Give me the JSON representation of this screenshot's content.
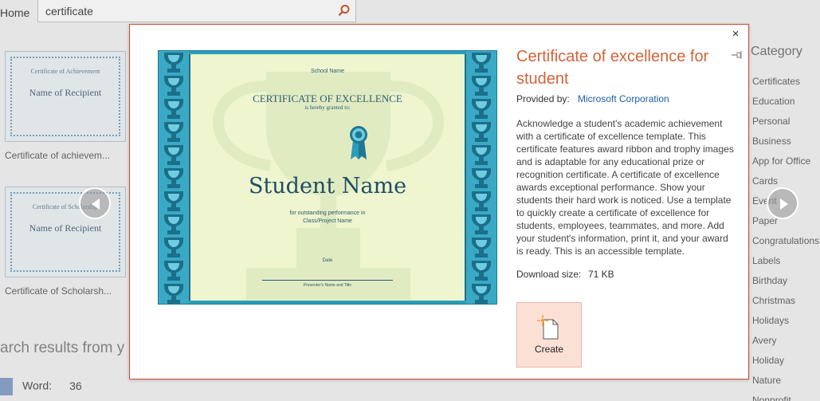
{
  "app": {
    "home_label": "Home",
    "search_value": "certificate"
  },
  "templates": [
    {
      "heading": "Certificate of Achievement",
      "recipient": "Name of Recipient",
      "label": "Certificate of achievem..."
    },
    {
      "heading": "Certificate of Scholarship",
      "recipient": "Name of Recipient",
      "label": "Certificate of Scholarsh..."
    }
  ],
  "search_results_text": "arch results from y",
  "word_results": {
    "label": "Word:",
    "count": "36"
  },
  "category": {
    "title": "Category",
    "items": [
      "Certificates",
      "Education",
      "Personal",
      "Business",
      "App for Office",
      "Cards",
      "Event",
      "Paper",
      "Congratulations",
      "Labels",
      "Birthday",
      "Christmas",
      "Holidays",
      "Avery",
      "Holiday",
      "Nature",
      "Nonprofit"
    ]
  },
  "dialog": {
    "title": "Certificate of excellence for student",
    "provided_by_label": "Provided by:",
    "provider": "Microsoft Corporation",
    "description": "Acknowledge a student's academic achievement with a certificate of excellence template. This certificate features award ribbon and trophy images and is adaptable for any educational prize or recognition certificate. A certificate of excellence awards exceptional performance. Show your students their hard work is noticed. Use a template to quickly create a certificate of excellence for students, employees, teammates, and more. Add your student's information, print it, and your award is ready. This is an accessible template.",
    "download_size_label": "Download size:",
    "download_size": "71 KB",
    "create_label": "Create",
    "close_glyph": "×"
  },
  "preview": {
    "school_name": "School Name",
    "title": "CERTIFICATE OF EXCELLENCE",
    "granted": "is hereby granted to:",
    "student_name": "Student Name",
    "for_text": "for outstanding performance in",
    "project": "Class/Project Name",
    "date": "Date",
    "presenter": "Presenter's Name and Title"
  },
  "colors": {
    "accent": "#d2643a",
    "link": "#1f5fa8",
    "dialog_border": "#cf4b2e",
    "create_bg": "#fbe0d6",
    "cert_teal": "#2b9dbb",
    "cert_paper": "#eef5cf"
  },
  "icons": [
    "search-icon",
    "close-icon",
    "pin-icon",
    "chevron-left-icon",
    "chevron-right-icon",
    "new-document-icon",
    "word-icon",
    "ribbon-icon",
    "trophy-icon"
  ]
}
